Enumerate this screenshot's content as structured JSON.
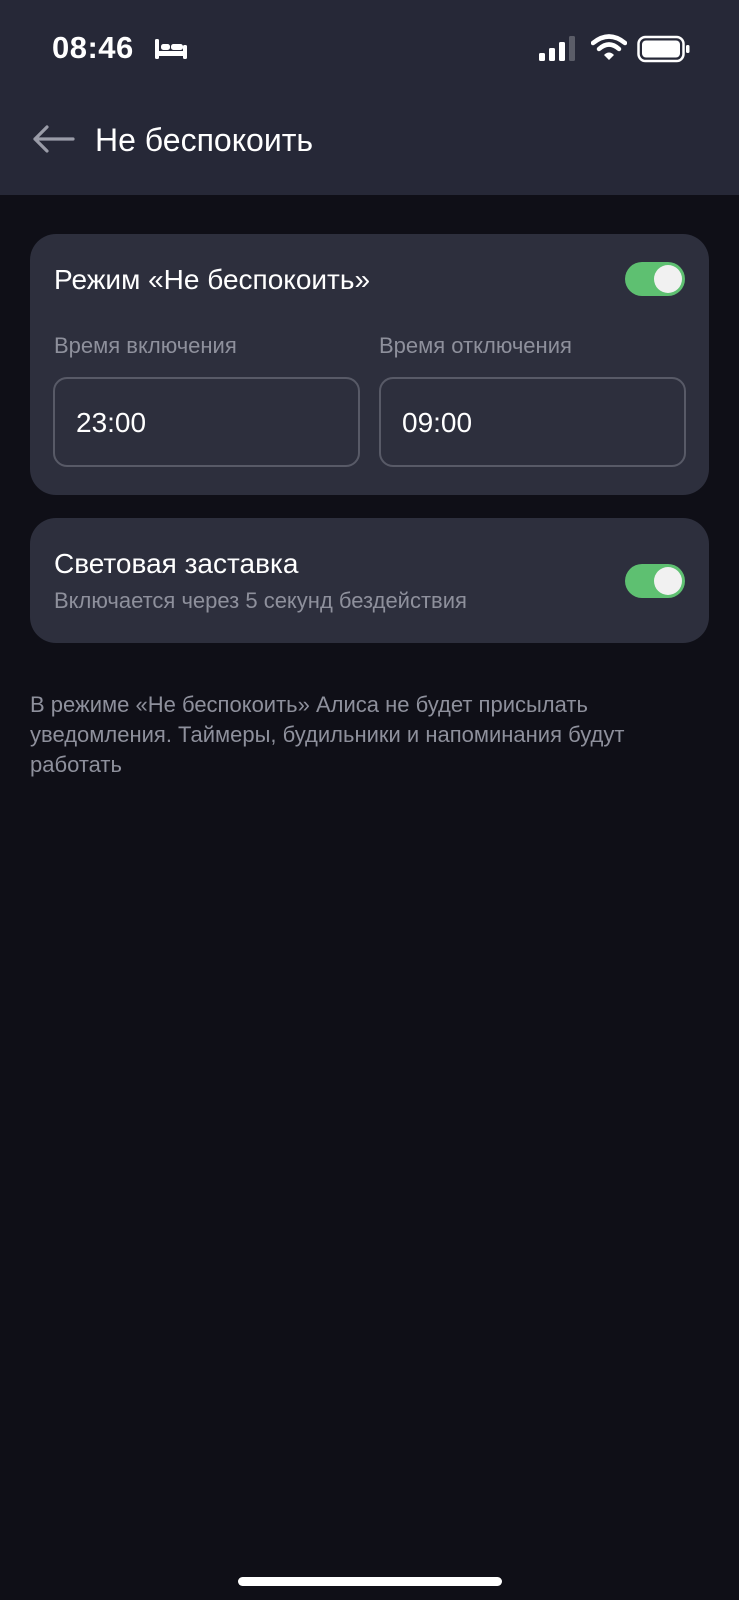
{
  "status_bar": {
    "time": "08:46",
    "icons": [
      "bed-icon",
      "signal-icon",
      "wifi-icon",
      "battery-icon"
    ]
  },
  "header": {
    "title": "Не беспокоить",
    "back_icon": "arrow-left-icon"
  },
  "dnd_card": {
    "title": "Режим «Не беспокоить»",
    "enabled": true,
    "start_label": "Время включения",
    "start_value": "23:00",
    "end_label": "Время отключения",
    "end_value": "09:00"
  },
  "screensaver_card": {
    "title": "Световая заставка",
    "subtitle": "Включается через 5 секунд бездействия",
    "enabled": true
  },
  "info": {
    "text": "В режиме «Не беспокоить» Алиса не будет присылать уведомления. Таймеры, будильники и напоминания будут работать"
  },
  "colors": {
    "background": "#0f0f17",
    "header": "#262837",
    "card": "#2d2f3d",
    "toggle_on": "#5ec071",
    "secondary_text": "#8e909c"
  }
}
